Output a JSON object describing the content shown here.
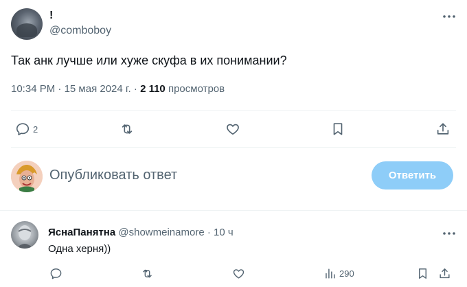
{
  "tweet": {
    "display_name": "!",
    "handle": "@comboboy",
    "text": "Так анк лучше или хуже скуфа в их понимании?",
    "time": "10:34 PM",
    "dot1": "·",
    "date": "15 мая 2024 г.",
    "dot2": "·",
    "views_count": "2 110",
    "views_label": "просмотров",
    "reply_count": "2"
  },
  "compose": {
    "placeholder": "Опубликовать ответ",
    "button_label": "Ответить",
    "button_color": "#8ecdf8"
  },
  "reply": {
    "display_name": "ЯснаПанятна",
    "handle": "@showmeinamore",
    "separator": "·",
    "time": "10 ч",
    "text": "Одна херня))",
    "views": "290"
  },
  "icons": [
    "more-icon",
    "reply-icon",
    "retweet-icon",
    "like-icon",
    "bookmark-icon",
    "share-icon",
    "views-icon"
  ],
  "colors": {
    "text": "#0f1419",
    "secondary": "#536471",
    "divider": "#eff3f4"
  }
}
